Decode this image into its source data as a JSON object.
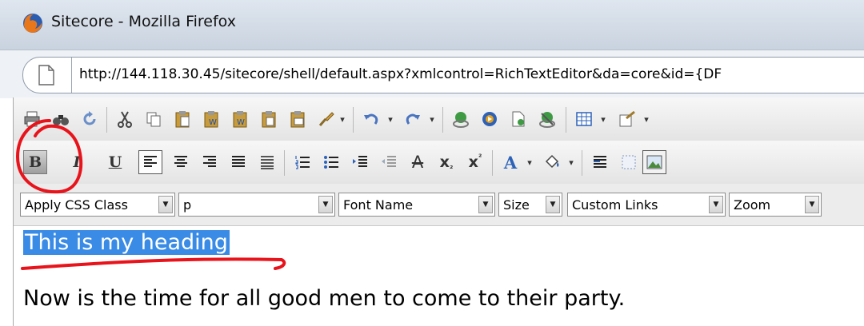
{
  "window": {
    "title": "Sitecore - Mozilla Firefox"
  },
  "address_bar": {
    "url": "http://144.118.30.45/sitecore/shell/default.aspx?xmlcontrol=RichTextEditor&da=core&id={DF"
  },
  "toolbar": {
    "bold_label": "B",
    "italic_label": "I",
    "underline_label": "U",
    "strike_label": "A",
    "subscript_label": "x",
    "superscript_label": "x",
    "font_color_label": "A"
  },
  "format_bar": {
    "css_class": "Apply CSS Class",
    "paragraph": "p",
    "font_name": "Font Name",
    "size": "Size",
    "links": "Custom Links",
    "zoom": "Zoom"
  },
  "content": {
    "heading": "This is my heading",
    "paragraph": "Now is the time for all good men to come to their party."
  },
  "colors": {
    "selection": "#3a8be5",
    "annotation": "#e8131b"
  }
}
